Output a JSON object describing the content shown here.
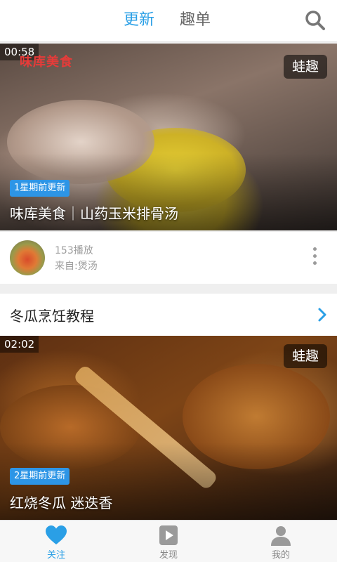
{
  "header": {
    "tabs": [
      {
        "label": "更新",
        "active": true
      },
      {
        "label": "趣单",
        "active": false
      }
    ],
    "search_icon": "search-icon",
    "accent_color": "#2a9fe6"
  },
  "feed": {
    "video1": {
      "duration": "00:58",
      "brand_logo": "味库美食",
      "channel_badge": "蛙趣",
      "update_badge": "1星期前更新",
      "title": "味库美食｜山药玉米排骨汤",
      "plays": "153播放",
      "source": "来自:煲汤"
    },
    "section": {
      "title": "冬瓜烹饪教程"
    },
    "video2": {
      "duration": "02:02",
      "channel_badge": "蛙趣",
      "update_badge": "2星期前更新",
      "title": "红烧冬瓜 迷迭香"
    }
  },
  "bottom_nav": [
    {
      "label": "关注",
      "icon": "heart-icon",
      "active": true
    },
    {
      "label": "发现",
      "icon": "play-icon",
      "active": false
    },
    {
      "label": "我的",
      "icon": "person-icon",
      "active": false
    }
  ]
}
